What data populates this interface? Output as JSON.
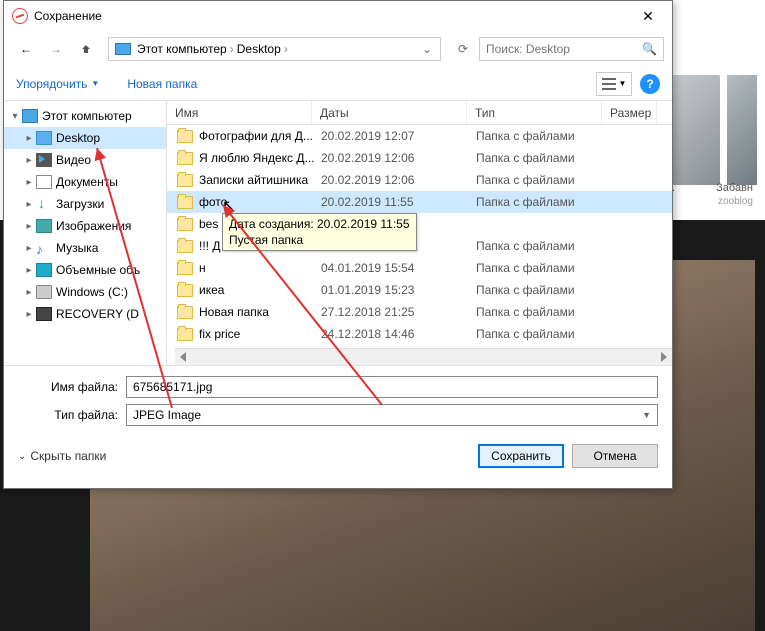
{
  "title": "Сохранение",
  "nav": {
    "breadcrumb": [
      "Этот компьютер",
      "Desktop"
    ],
    "search_placeholder": "Поиск: Desktop"
  },
  "toolbar": {
    "organize": "Упорядочить",
    "new_folder": "Новая папка"
  },
  "columns": {
    "name": "Имя",
    "date": "Даты",
    "type": "Тип",
    "size": "Размер"
  },
  "sidebar": [
    {
      "label": "Этот компьютер",
      "icon": "pc",
      "exp": "▾",
      "depth": 0
    },
    {
      "label": "Desktop",
      "icon": "desktop",
      "exp": "▸",
      "depth": 1,
      "selected": true
    },
    {
      "label": "Видео",
      "icon": "video",
      "exp": "▸",
      "depth": 1
    },
    {
      "label": "Документы",
      "icon": "doc",
      "exp": "▸",
      "depth": 1
    },
    {
      "label": "Загрузки",
      "icon": "down",
      "exp": "▸",
      "depth": 1
    },
    {
      "label": "Изображения",
      "icon": "img",
      "exp": "▸",
      "depth": 1
    },
    {
      "label": "Музыка",
      "icon": "music",
      "exp": "▸",
      "depth": 1
    },
    {
      "label": "Объемные объ",
      "icon": "cube",
      "exp": "▸",
      "depth": 1
    },
    {
      "label": "Windows (C:)",
      "icon": "disk",
      "exp": "▸",
      "depth": 1
    },
    {
      "label": "RECOVERY (D",
      "icon": "rec",
      "exp": "▸",
      "depth": 1
    }
  ],
  "files": [
    {
      "name": "Фотографии для Д...",
      "date": "20.02.2019 12:07",
      "type": "Папка с файлами"
    },
    {
      "name": "Я люблю Яндекс Д...",
      "date": "20.02.2019 12:06",
      "type": "Папка с файлами"
    },
    {
      "name": "Записки айтишника",
      "date": "20.02.2019 12:06",
      "type": "Папка с файлами"
    },
    {
      "name": "фото",
      "date": "20.02.2019 11:55",
      "type": "Папка с файлами",
      "selected": true
    },
    {
      "name": "bes",
      "date": "",
      "type": ""
    },
    {
      "name": "!!! Д",
      "date": "",
      "type": "Папка с файлами"
    },
    {
      "name": "н",
      "date": "04.01.2019 15:54",
      "type": "Папка с файлами"
    },
    {
      "name": "икеа",
      "date": "01.01.2019 15:23",
      "type": "Папка с файлами"
    },
    {
      "name": "Новая папка",
      "date": "27.12.2018 21:25",
      "type": "Папка с файлами"
    },
    {
      "name": "fix price",
      "date": "24.12.2018 14:46",
      "type": "Папка с файлами"
    }
  ],
  "tooltip": {
    "line1": "Дата создания: 20.02.2019 11:55",
    "line2": "Пустая папка"
  },
  "form": {
    "filename_label": "Имя файла:",
    "filename_value": "675685171.jpg",
    "filetype_label": "Тип файла:",
    "filetype_value": "JPEG Image"
  },
  "buttons": {
    "hide_folders": "Скрыть папки",
    "save": "Сохранить",
    "cancel": "Отмена"
  },
  "bg": {
    "cap1": "2...",
    "cap2": "Забавн",
    "cap3": "zooblog"
  }
}
